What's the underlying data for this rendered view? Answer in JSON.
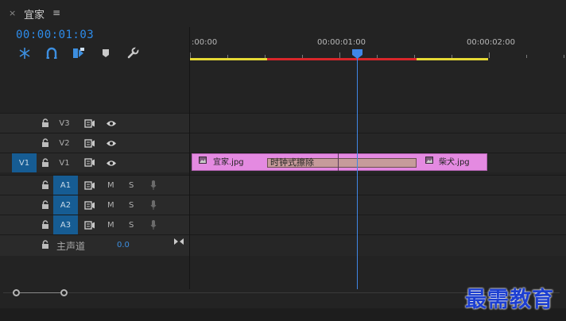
{
  "panel": {
    "close_glyph": "×",
    "title": "宜家",
    "menu_glyph": "≡"
  },
  "timecode": "00:00:01:03",
  "tools": [
    "snap-icon",
    "linked-selection-icon",
    "insert-edit-icon",
    "marker-icon",
    "wrench-icon"
  ],
  "ruler": {
    "labels": [
      ":00:00",
      "00:00:01:00",
      "00:00:02:00"
    ]
  },
  "tracks": {
    "v3": {
      "label": "V3"
    },
    "v2": {
      "label": "V2"
    },
    "v1": {
      "source": "V1",
      "label": "V1"
    },
    "a1": {
      "label": "A1",
      "m": "M",
      "s": "S"
    },
    "a2": {
      "label": "A2",
      "m": "M",
      "s": "S"
    },
    "a3": {
      "label": "A3",
      "m": "M",
      "s": "S"
    },
    "master": {
      "label": "主声道",
      "value": "0.0"
    }
  },
  "clips": {
    "clip1": {
      "name": "宜家.jpg"
    },
    "transition": {
      "name": "时钟式擦除"
    },
    "clip2": {
      "name": "柴犬.jpg"
    }
  },
  "colors": {
    "accent": "#2d8ceb",
    "target": "#165c93",
    "clip": "#e48ae1",
    "workbar_yellow": "#e5d935",
    "workbar_red": "#d8262a"
  },
  "watermark": "最需教育"
}
